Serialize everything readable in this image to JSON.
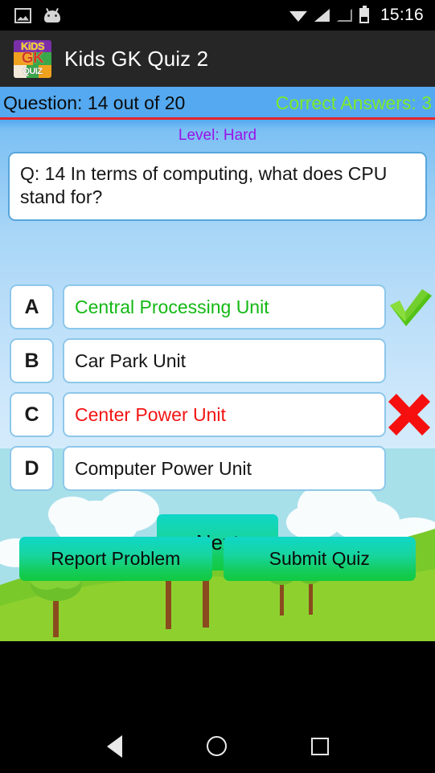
{
  "statusbar": {
    "time": "15:16",
    "icons": [
      "image-icon",
      "android-head-icon",
      "wifi-icon",
      "signal-icon",
      "signal-empty-icon",
      "battery-icon"
    ]
  },
  "titlebar": {
    "app_title": "Kids GK Quiz 2",
    "logo": {
      "line1": "KiDS",
      "line2": "GK",
      "line3": "QUIZ"
    }
  },
  "infobar": {
    "question_counter": "Question: 14 out of 20",
    "correct_counter": "Correct Answers: 3",
    "background": "#54a9f0",
    "divider_color": "#e8232a",
    "correct_color": "#7dea2a"
  },
  "quiz": {
    "level": "Level: Hard",
    "level_color": "#9a12e8",
    "question": "Q: 14  In terms of computing, what does CPU stand for?",
    "options": [
      {
        "letter": "A",
        "text": "Central Processing Unit",
        "state": "correct",
        "mark": "check-icon"
      },
      {
        "letter": "B",
        "text": "Car Park Unit",
        "state": "neutral",
        "mark": ""
      },
      {
        "letter": "C",
        "text": "Center Power Unit",
        "state": "wrong",
        "mark": "cross-icon"
      },
      {
        "letter": "D",
        "text": "Computer Power Unit",
        "state": "neutral",
        "mark": ""
      }
    ],
    "correct_color": "#14b814",
    "wrong_color": "#f31414"
  },
  "buttons": {
    "next": "Next",
    "report_problem": "Report Problem",
    "submit_quiz": "Submit Quiz"
  },
  "navbar": {
    "back": "back-icon",
    "home": "home-icon",
    "recents": "recents-icon"
  }
}
